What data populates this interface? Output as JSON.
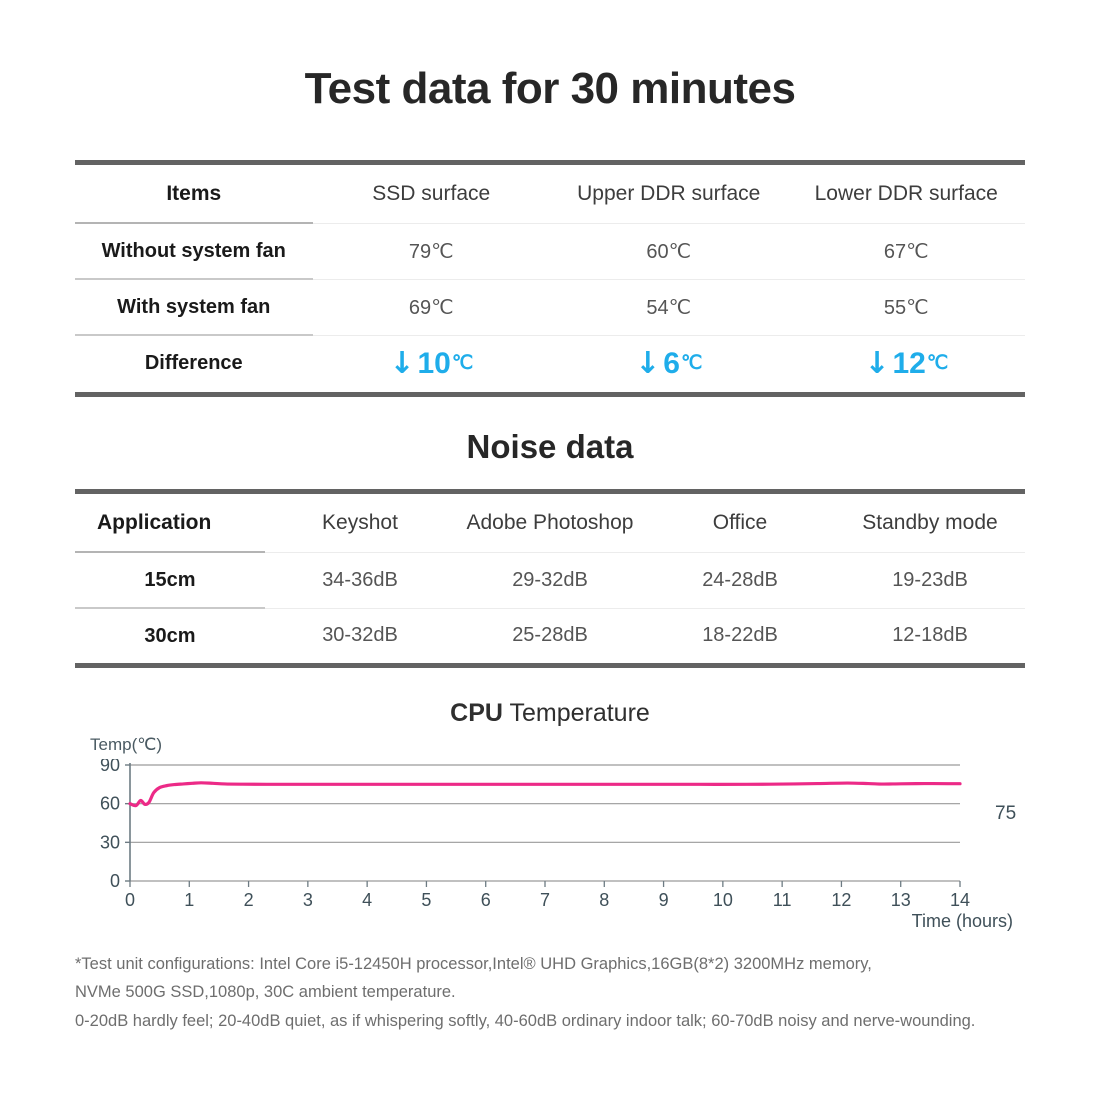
{
  "main_title": "Test data for 30 minutes",
  "thermal_table": {
    "headers": [
      "Items",
      "SSD surface",
      "Upper DDR surface",
      "Lower DDR surface"
    ],
    "rows": [
      {
        "label": "Without system fan",
        "values": [
          "79℃",
          "60℃",
          "67℃"
        ]
      },
      {
        "label": "With system fan",
        "values": [
          "69℃",
          "54℃",
          "55℃"
        ]
      }
    ],
    "difference": {
      "label": "Difference",
      "arrow": "↓",
      "values": [
        {
          "number": "10",
          "unit": "℃"
        },
        {
          "number": "6",
          "unit": "℃"
        },
        {
          "number": "12",
          "unit": "℃"
        }
      ],
      "color": "#1fadea"
    }
  },
  "noise_section_title": "Noise data",
  "noise_table": {
    "headers": [
      "Application",
      "Keyshot",
      "Adobe Photoshop",
      "Office",
      "Standby mode"
    ],
    "rows": [
      {
        "label": "15cm",
        "values": [
          "34-36dB",
          "29-32dB",
          "24-28dB",
          "19-23dB"
        ]
      },
      {
        "label": "30cm",
        "values": [
          "30-32dB",
          "25-28dB",
          "18-22dB",
          "12-18dB"
        ]
      }
    ]
  },
  "chart_title_bold": "CPU",
  "chart_title_rest": " Temperature",
  "chart_data": {
    "type": "line",
    "title": "CPU Temperature",
    "xlabel": "Time (hours)",
    "ylabel": "Temp(℃)",
    "xlim": [
      0,
      14
    ],
    "ylim": [
      0,
      90
    ],
    "xticks": [
      "0",
      "1",
      "2",
      "3",
      "4",
      "5",
      "6",
      "7",
      "8",
      "9",
      "10",
      "11",
      "12",
      "13",
      "14"
    ],
    "yticks": [
      "0",
      "30",
      "60",
      "90"
    ],
    "grid": true,
    "legend": "none",
    "line_color": "#ec2a87",
    "end_label": "75",
    "series": [
      {
        "name": "CPU Temperature",
        "x": [
          0.0,
          0.1,
          0.18,
          0.25,
          0.32,
          0.4,
          0.5,
          0.62,
          0.75,
          0.9,
          1.05,
          1.2,
          1.4,
          1.6,
          1.9,
          2.3,
          2.8,
          3.4,
          4.0,
          4.8,
          5.6,
          6.4,
          7.2,
          8.0,
          8.8,
          9.6,
          10.4,
          11.0,
          11.6,
          12.1,
          12.45,
          12.7,
          13.0,
          13.4,
          13.8,
          14.0
        ],
        "y": [
          60.0,
          58.5,
          62.5,
          59.5,
          61.0,
          68.5,
          72.5,
          74.0,
          74.8,
          75.3,
          75.8,
          76.2,
          75.8,
          75.3,
          75.1,
          75.0,
          75.0,
          75.0,
          75.0,
          75.0,
          75.0,
          75.0,
          75.0,
          75.0,
          75.0,
          75.0,
          75.0,
          75.2,
          75.6,
          76.0,
          75.6,
          75.2,
          75.4,
          75.6,
          75.5,
          75.5
        ]
      }
    ]
  },
  "footnotes": [
    "*Test unit configurations: Intel Core i5-12450H processor,Intel® UHD Graphics,16GB(8*2) 3200MHz memory,",
    "NVMe 500G SSD,1080p, 30C ambient temperature.",
    "0-20dB hardly feel; 20-40dB quiet, as if whispering softly, 40-60dB ordinary indoor talk; 60-70dB noisy and nerve-wounding."
  ]
}
